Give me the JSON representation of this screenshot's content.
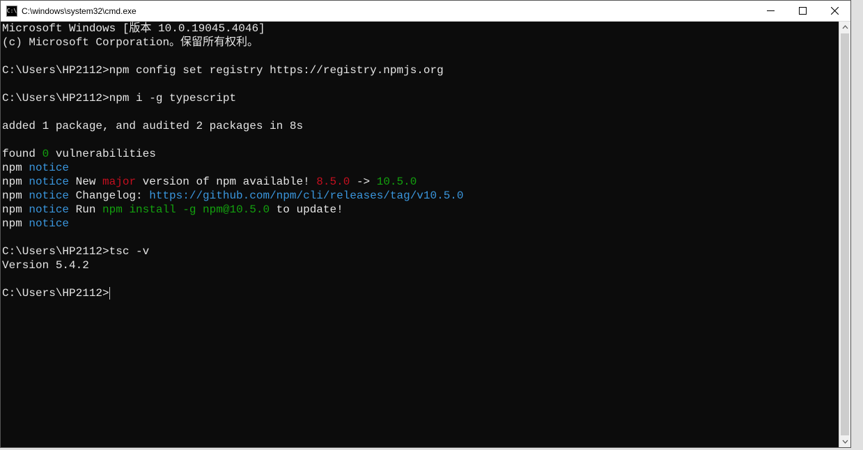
{
  "window": {
    "icon_text": "C:\\",
    "title": "C:\\windows\\system32\\cmd.exe"
  },
  "terminal": {
    "line0": "Microsoft Windows [版本 10.0.19045.4046]",
    "line1": "(c) Microsoft Corporation。保留所有权利。",
    "blank": "",
    "p1_prompt": "C:\\Users\\HP2112>",
    "p1_cmd": "npm config set registry https://registry.npmjs.org",
    "p2_prompt": "C:\\Users\\HP2112>",
    "p2_cmd": "npm i -g typescript",
    "added": "added 1 package, and audited 2 packages in 8s",
    "found_pre": "found ",
    "found_zero": "0",
    "found_post": " vulnerabilities",
    "npm": "npm ",
    "notice": "notice",
    "nv_new": " New ",
    "nv_major": "major",
    "nv_a": " version of npm available! ",
    "nv_old": "8.5.0",
    "nv_arrow": " -> ",
    "nv_newv": "10.5.0",
    "cl_pre": " Changelog: ",
    "cl_url": "https://github.com/npm/cli/releases/tag/v10.5.0",
    "run_pre": " Run ",
    "run_cmd": "npm install -g npm@10.5.0",
    "run_post": " to update!",
    "p3_prompt": "C:\\Users\\HP2112>",
    "p3_cmd": "tsc -v",
    "version": "Version 5.4.2",
    "p4_prompt": "C:\\Users\\HP2112>"
  }
}
